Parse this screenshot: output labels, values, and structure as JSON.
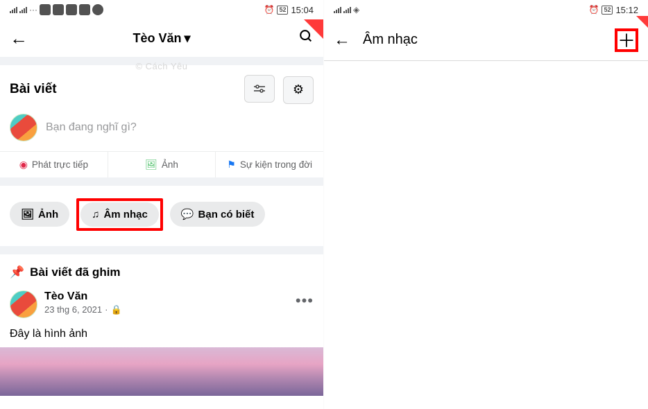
{
  "left": {
    "status": {
      "battery": "52",
      "time": "15:04"
    },
    "header": {
      "title": "Tèo Văn"
    },
    "posts_label": "Bài viết",
    "composer_placeholder": "Bạn đang nghĩ gì?",
    "options": {
      "live": "Phát trực tiếp",
      "photo": "Ảnh",
      "event": "Sự kiện trong đời"
    },
    "pills": {
      "photo": "Ảnh",
      "music": "Âm nhạc",
      "did_you_know": "Bạn có biết"
    },
    "pinned_label": "Bài viết đã ghim",
    "post": {
      "author": "Tèo Văn",
      "date": "23 thg 6, 2021",
      "body": "Đây là hình ảnh"
    }
  },
  "right": {
    "status": {
      "battery": "52",
      "time": "15:12"
    },
    "header": {
      "title": "Âm nhạc"
    }
  },
  "watermark": "© Cách Yêu"
}
